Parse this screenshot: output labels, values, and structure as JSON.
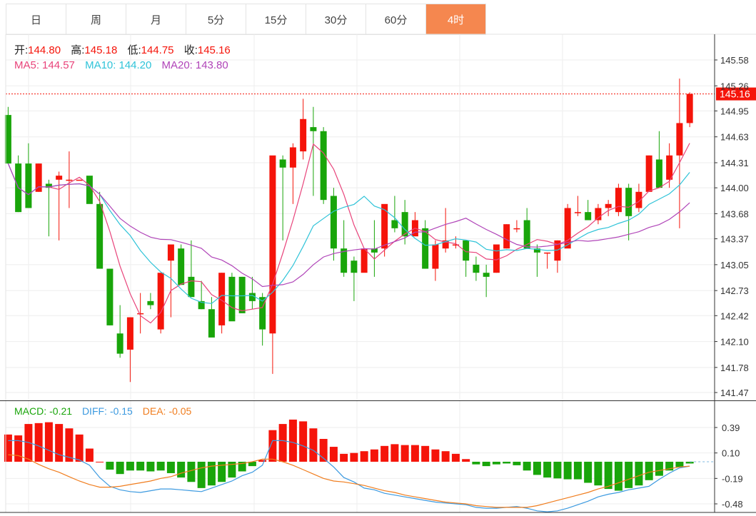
{
  "tabs": [
    {
      "label": "日"
    },
    {
      "label": "周"
    },
    {
      "label": "月"
    },
    {
      "label": "5分"
    },
    {
      "label": "15分"
    },
    {
      "label": "30分"
    },
    {
      "label": "60分"
    },
    {
      "label": "4时",
      "active": true
    }
  ],
  "info": {
    "open_label": "开:",
    "open_value": "144.80",
    "high_label": "高:",
    "high_value": "145.18",
    "low_label": "低:",
    "low_value": "144.75",
    "close_label": "收:",
    "close_value": "145.16",
    "ma5_label": "MA5:",
    "ma5_value": "144.57",
    "ma10_label": "MA10:",
    "ma10_value": "144.20",
    "ma20_label": "MA20:",
    "ma20_value": "143.80"
  },
  "macd_info": {
    "macd_label": "MACD:",
    "macd_value": "-0.21",
    "diff_label": "DIFF:",
    "diff_value": "-0.15",
    "dea_label": "DEA:",
    "dea_value": "-0.05"
  },
  "colors": {
    "up": "#f5140a",
    "down": "#19a50a",
    "ma5": "#e8437a",
    "ma10": "#2fc3d8",
    "ma20": "#b044b8",
    "diff": "#3c9ae0",
    "dea": "#f07d1e",
    "active_tab": "#f5874f",
    "last_price": "#f5140a"
  },
  "chart_data": [
    {
      "type": "candlestick",
      "ylim": [
        141.4,
        145.75
      ],
      "yticks": [
        "145.58",
        "145.26",
        "144.95",
        "144.63",
        "144.31",
        "144.00",
        "143.68",
        "143.37",
        "143.05",
        "142.73",
        "142.42",
        "142.10",
        "141.78",
        "141.47"
      ],
      "last_price": "145.16",
      "ohlc": [
        [
          144.9,
          145.0,
          144.3,
          144.3
        ],
        [
          144.3,
          144.4,
          143.7,
          143.7
        ],
        [
          144.3,
          144.55,
          143.75,
          143.75
        ],
        [
          143.95,
          144.3,
          143.95,
          144.3
        ],
        [
          144.05,
          144.1,
          143.4,
          144.0
        ],
        [
          144.1,
          144.2,
          143.35,
          144.15
        ],
        [
          144.1,
          144.45,
          143.75,
          144.1
        ],
        [
          144.1,
          144.1,
          144.1,
          144.1
        ],
        [
          144.15,
          144.1,
          143.9,
          143.8
        ],
        [
          143.8,
          143.95,
          143.0,
          143.0
        ],
        [
          143.0,
          143.0,
          142.3,
          142.3
        ],
        [
          142.2,
          142.55,
          141.9,
          141.95
        ],
        [
          142.0,
          142.4,
          141.6,
          142.4
        ],
        [
          142.45,
          142.7,
          142.2,
          142.45
        ],
        [
          142.6,
          142.7,
          142.5,
          142.55
        ],
        [
          142.25,
          142.9,
          142.2,
          142.95
        ],
        [
          143.1,
          143.3,
          142.4,
          143.3
        ],
        [
          143.25,
          143.3,
          142.8,
          142.8
        ],
        [
          142.9,
          143.35,
          142.65,
          142.65
        ],
        [
          142.6,
          142.85,
          142.5,
          142.5
        ],
        [
          142.5,
          142.65,
          142.25,
          142.15
        ],
        [
          142.3,
          142.95,
          142.2,
          142.95
        ],
        [
          142.9,
          142.95,
          142.65,
          142.35
        ],
        [
          142.9,
          142.9,
          142.55,
          142.45
        ],
        [
          142.7,
          142.9,
          142.5,
          142.6
        ],
        [
          142.65,
          142.7,
          142.05,
          142.25
        ],
        [
          142.2,
          144.35,
          141.7,
          144.4
        ],
        [
          144.35,
          144.4,
          143.35,
          144.25
        ],
        [
          144.25,
          144.55,
          143.8,
          144.5
        ],
        [
          144.45,
          145.1,
          144.35,
          144.85
        ],
        [
          144.75,
          145.0,
          143.9,
          144.7
        ],
        [
          144.7,
          144.75,
          143.8,
          143.85
        ],
        [
          143.9,
          144.0,
          143.1,
          143.25
        ],
        [
          143.25,
          143.6,
          142.9,
          142.95
        ],
        [
          143.1,
          143.15,
          142.6,
          142.95
        ],
        [
          142.95,
          143.25,
          143.05,
          143.25
        ],
        [
          143.25,
          143.6,
          142.9,
          143.2
        ],
        [
          143.25,
          143.75,
          143.15,
          143.8
        ],
        [
          143.6,
          143.9,
          143.45,
          143.5
        ],
        [
          143.7,
          143.85,
          143.3,
          143.4
        ],
        [
          143.4,
          143.7,
          143.45,
          143.6
        ],
        [
          143.5,
          143.6,
          143.0,
          143.0
        ],
        [
          143.0,
          143.35,
          142.85,
          143.3
        ],
        [
          143.25,
          143.75,
          143.2,
          143.35
        ],
        [
          143.3,
          143.4,
          143.25,
          143.3
        ],
        [
          143.35,
          143.35,
          142.9,
          143.1
        ],
        [
          143.05,
          143.15,
          142.85,
          142.95
        ],
        [
          142.95,
          143.05,
          142.65,
          142.9
        ],
        [
          142.95,
          143.3,
          142.95,
          143.3
        ],
        [
          143.25,
          143.55,
          143.25,
          143.55
        ],
        [
          143.5,
          143.6,
          143.45,
          143.5
        ],
        [
          143.6,
          143.75,
          143.3,
          143.25
        ],
        [
          143.25,
          143.3,
          142.9,
          143.2
        ],
        [
          143.2,
          143.2,
          143.0,
          143.2
        ],
        [
          143.1,
          143.35,
          142.95,
          143.35
        ],
        [
          143.25,
          143.8,
          143.3,
          143.75
        ],
        [
          143.7,
          143.9,
          143.65,
          143.7
        ],
        [
          143.7,
          143.85,
          143.6,
          143.6
        ],
        [
          143.6,
          143.8,
          143.55,
          143.75
        ],
        [
          143.75,
          143.85,
          143.65,
          143.8
        ],
        [
          143.7,
          144.05,
          143.65,
          144.0
        ],
        [
          144.0,
          144.05,
          143.35,
          143.65
        ],
        [
          143.75,
          144.05,
          143.7,
          143.95
        ],
        [
          143.95,
          144.4,
          143.95,
          144.4
        ],
        [
          144.35,
          144.7,
          144.0,
          144.0
        ],
        [
          144.1,
          144.55,
          144.0,
          144.4
        ],
        [
          144.4,
          145.35,
          143.5,
          144.8
        ],
        [
          144.8,
          145.18,
          144.75,
          145.16
        ]
      ]
    },
    {
      "type": "bar",
      "ylim": [
        -0.57,
        0.52
      ],
      "yticks": [
        "0.39",
        "0.10",
        "-0.19",
        "-0.48"
      ],
      "macd": [
        0.31,
        0.3,
        0.43,
        0.44,
        0.45,
        0.43,
        0.38,
        0.31,
        0.15,
        0.0,
        -0.09,
        -0.14,
        -0.1,
        -0.1,
        -0.11,
        -0.1,
        -0.13,
        -0.18,
        -0.23,
        -0.3,
        -0.27,
        -0.23,
        -0.18,
        -0.11,
        -0.05,
        0.02,
        0.36,
        0.43,
        0.48,
        0.46,
        0.38,
        0.26,
        0.17,
        0.09,
        0.1,
        0.12,
        0.14,
        0.18,
        0.2,
        0.19,
        0.19,
        0.18,
        0.14,
        0.12,
        0.09,
        0.03,
        -0.03,
        -0.05,
        -0.03,
        -0.02,
        -0.04,
        -0.1,
        -0.15,
        -0.18,
        -0.19,
        -0.2,
        -0.2,
        -0.24,
        -0.27,
        -0.31,
        -0.33,
        -0.3,
        -0.27,
        -0.21,
        -0.16,
        -0.1,
        -0.06,
        -0.02
      ],
      "diff": [
        0.24,
        0.24,
        0.22,
        0.18,
        0.13,
        0.08,
        0.05,
        0.02,
        -0.04,
        -0.18,
        -0.28,
        -0.32,
        -0.34,
        -0.35,
        -0.33,
        -0.31,
        -0.31,
        -0.32,
        -0.33,
        -0.34,
        -0.3,
        -0.26,
        -0.22,
        -0.16,
        -0.12,
        -0.04,
        0.24,
        0.24,
        0.22,
        0.18,
        0.13,
        0.04,
        -0.06,
        -0.18,
        -0.23,
        -0.3,
        -0.32,
        -0.36,
        -0.38,
        -0.4,
        -0.42,
        -0.44,
        -0.46,
        -0.47,
        -0.48,
        -0.49,
        -0.52,
        -0.53,
        -0.53,
        -0.52,
        -0.51,
        -0.53,
        -0.56,
        -0.57,
        -0.56,
        -0.53,
        -0.49,
        -0.45,
        -0.4,
        -0.37,
        -0.35,
        -0.32,
        -0.3,
        -0.28,
        -0.2,
        -0.13,
        -0.07,
        -0.05
      ],
      "dea": [
        0.08,
        0.07,
        0.03,
        -0.03,
        -0.08,
        -0.12,
        -0.17,
        -0.22,
        -0.26,
        -0.29,
        -0.29,
        -0.28,
        -0.26,
        -0.24,
        -0.22,
        -0.19,
        -0.17,
        -0.13,
        -0.1,
        -0.07,
        -0.05,
        -0.04,
        -0.03,
        -0.02,
        0.0,
        0.03,
        0.03,
        0.0,
        -0.04,
        -0.09,
        -0.14,
        -0.19,
        -0.22,
        -0.23,
        -0.25,
        -0.27,
        -0.3,
        -0.33,
        -0.35,
        -0.38,
        -0.4,
        -0.42,
        -0.44,
        -0.46,
        -0.47,
        -0.48,
        -0.5,
        -0.51,
        -0.52,
        -0.52,
        -0.52,
        -0.52,
        -0.5,
        -0.47,
        -0.44,
        -0.41,
        -0.38,
        -0.35,
        -0.31,
        -0.28,
        -0.24,
        -0.2,
        -0.16,
        -0.12,
        -0.1,
        -0.08,
        -0.06,
        -0.05
      ]
    }
  ]
}
